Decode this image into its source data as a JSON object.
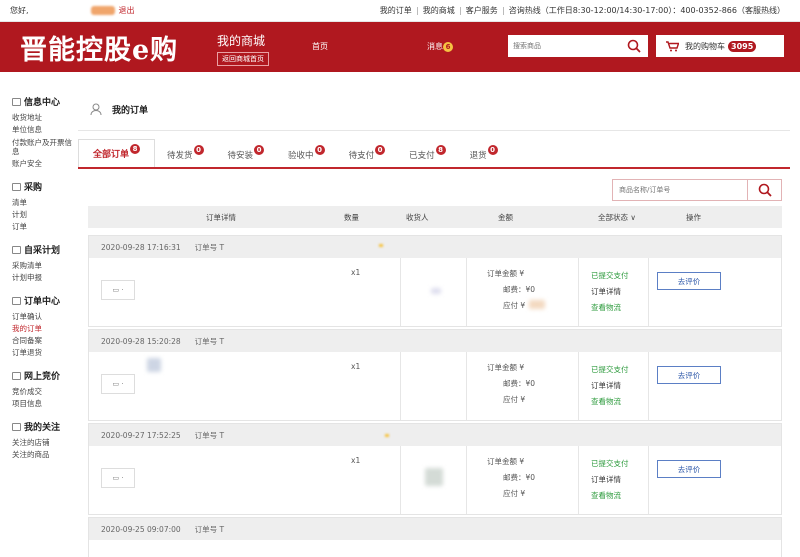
{
  "topbar": {
    "greeting": "您好,",
    "logout": "退出",
    "links": [
      "我的订单",
      "我的商城",
      "客户服务",
      "咨询热线（工作日8:30-12:00/14:30-17:00）：400-0352-866（客服热线）"
    ]
  },
  "header": {
    "logo": "晋能控股e购",
    "mall_title": "我的商城",
    "back_home": "返回商城首页",
    "nav_home": "首页",
    "nav_message": "消息",
    "message_count": "6",
    "search_placeholder": "搜索商品",
    "cart_label": "我的购物车",
    "cart_count": "3095"
  },
  "sidebar": {
    "groups": [
      {
        "title": "信息中心",
        "items": [
          "收货地址",
          "单位信息",
          "付款账户及开票信息",
          "账户安全"
        ]
      },
      {
        "title": "采购",
        "items": [
          "清单",
          "计划",
          "订单"
        ]
      },
      {
        "title": "自采计划",
        "items": [
          "采购清单",
          "计划申报"
        ]
      },
      {
        "title": "订单中心",
        "items": [
          "订单确认",
          "我的订单",
          "合同备案",
          "订单退货"
        ]
      },
      {
        "title": "网上竞价",
        "items": [
          "竞价成交",
          "项目信息"
        ]
      },
      {
        "title": "我的关注",
        "items": [
          "关注的店铺",
          "关注的商品"
        ]
      }
    ]
  },
  "page": {
    "breadcrumb": "我的订单",
    "tabs": [
      {
        "label": "全部订单",
        "count": "8"
      },
      {
        "label": "待发货",
        "count": "0"
      },
      {
        "label": "待安装",
        "count": "0"
      },
      {
        "label": "验收中",
        "count": "0"
      },
      {
        "label": "待支付",
        "count": "0"
      },
      {
        "label": "已支付",
        "count": "8"
      },
      {
        "label": "退货",
        "count": "0"
      }
    ],
    "order_search_placeholder": "商品名称/订单号",
    "columns": [
      "订单详情",
      "数量",
      "收货人",
      "金额",
      "全部状态",
      "操作"
    ],
    "amount_labels": {
      "total": "订单金额 ¥",
      "shipping": "邮费：¥0",
      "payable": "应付 ¥"
    },
    "status_labels": {
      "submitted": "已提交支付",
      "detail": "订单详情",
      "logistics": "查看物流"
    },
    "review_label": "去评价",
    "qty_label": "x1",
    "order_no_prefix": "订单号 T",
    "orders": [
      {
        "time": "2020-09-28 17:16:31"
      },
      {
        "time": "2020-09-28 15:20:28"
      },
      {
        "time": "2020-09-27 17:52:25"
      },
      {
        "time": "2020-09-25 09:07:00"
      }
    ]
  },
  "colors": {
    "brand_red": "#b0181f",
    "status_green": "#2e9b3e",
    "link_blue": "#2a55a8"
  }
}
